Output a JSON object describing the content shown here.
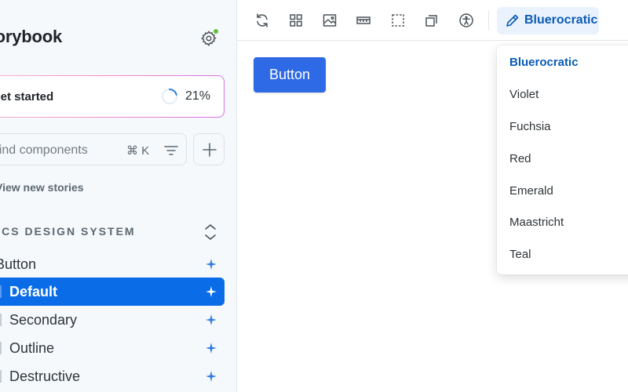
{
  "sidebar": {
    "brand": "Storybook",
    "progress": {
      "label": "Get started",
      "percent_text": "21%",
      "percent": 21
    },
    "search": {
      "placeholder": "Find components",
      "shortcut": "⌘ K"
    },
    "view_new": "View new stories",
    "group": {
      "title": "RCS DESIGN SYSTEM"
    },
    "tree": [
      {
        "label": "Button",
        "selected": false
      },
      {
        "label": "Default",
        "selected": true
      },
      {
        "label": "Secondary",
        "selected": false
      },
      {
        "label": "Outline",
        "selected": false
      },
      {
        "label": "Destructive",
        "selected": false
      }
    ]
  },
  "toolbar": {
    "icons": [
      "reload-icon",
      "grid-icon",
      "image-icon",
      "ruler-icon",
      "outline-icon",
      "layers-icon",
      "accessibility-icon"
    ],
    "theme_label": "Bluerocratic"
  },
  "canvas": {
    "button_label": "Button"
  },
  "theme_menu": {
    "options": [
      "Bluerocratic",
      "Violet",
      "Fuchsia",
      "Red",
      "Emerald",
      "Maastricht",
      "Teal"
    ],
    "selected": "Bluerocratic"
  },
  "colors": {
    "accent": "#0b6ce8",
    "theme_text": "#0a5bb5",
    "preview_button": "#2f6ae6",
    "status_dot": "#66bf3c"
  }
}
